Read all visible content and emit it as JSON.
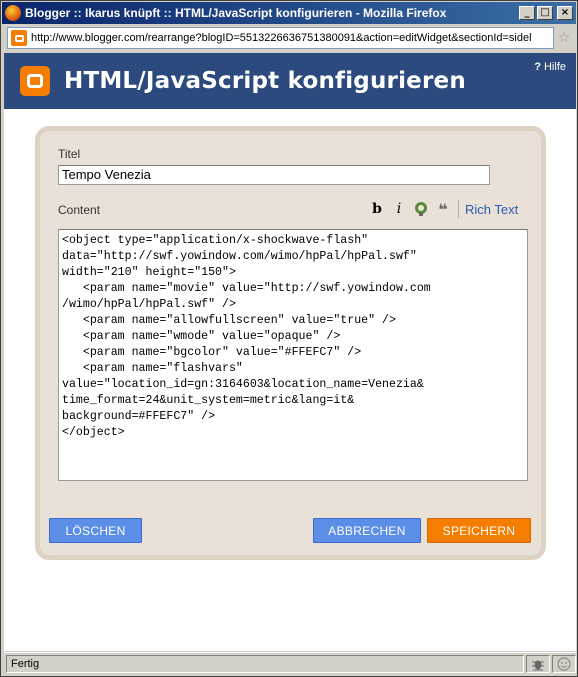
{
  "window": {
    "title": "Blogger :: Ikarus knüpft :: HTML/JavaScript konfigurieren - Mozilla Firefox",
    "buttons": {
      "minimize": "_",
      "maximize": "□",
      "close": "×"
    }
  },
  "addressbar": {
    "url": "http://www.blogger.com/rearrange?blogID=5513226636751380091&action=editWidget&sectionId=sidel"
  },
  "header": {
    "title": "HTML/JavaScript konfigurieren",
    "help": "Hilfe",
    "help_mark": "?"
  },
  "form": {
    "title_label": "Titel",
    "title_value": "Tempo Venezia",
    "content_label": "Content",
    "toolbar": {
      "bold": "b",
      "italic": "i",
      "quote": "❝",
      "rich_text": "Rich Text"
    },
    "content_value": "<object type=\"application/x-shockwave-flash\"\ndata=\"http://swf.yowindow.com/wimo/hpPal/hpPal.swf\"\nwidth=\"210\" height=\"150\">\n   <param name=\"movie\" value=\"http://swf.yowindow.com\n/wimo/hpPal/hpPal.swf\" />\n   <param name=\"allowfullscreen\" value=\"true\" />\n   <param name=\"wmode\" value=\"opaque\" />\n   <param name=\"bgcolor\" value=\"#FFEFC7\" />\n   <param name=\"flashvars\"\nvalue=\"location_id=gn:3164603&location_name=Venezia&\ntime_format=24&unit_system=metric&lang=it&\nbackground=#FFEFC7\" />\n</object>",
    "buttons": {
      "delete": "LÖSCHEN",
      "cancel": "ABBRECHEN",
      "save": "SPEICHERN"
    }
  },
  "statusbar": {
    "text": "Fertig"
  },
  "colors": {
    "header_bg": "#2c4a7d",
    "accent_orange": "#f57d00",
    "button_blue": "#5b8ee6",
    "panel_bg": "#e9e1d7"
  }
}
